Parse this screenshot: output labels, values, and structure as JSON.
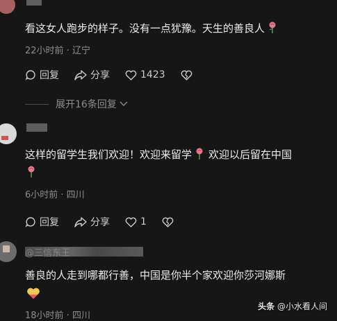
{
  "comments": [
    {
      "text": "看这女人跑步的样子。没有一点犹豫。天生的善良人",
      "meta": "22小时前 · 辽宁",
      "reply": "回复",
      "share": "分享",
      "likes": "1423",
      "dislike_icon": "broken-heart-icon"
    },
    {
      "text_line1": "这样的留学生我们欢迎！欢迎来留学",
      "text_line1b": "欢迎以后留在中国",
      "meta": "6小时前 · 四川",
      "reply": "回复",
      "share": "分享",
      "likes": "1"
    },
    {
      "username": "@三信东王",
      "text": "善良的人走到哪都行善，中国是你半个家欢迎你莎河娜斯",
      "meta": "18小时前 · 四川"
    }
  ],
  "expand_replies": "展开16条回复",
  "watermark": {
    "brand": "头条",
    "handle": "@小水看人间"
  },
  "colors": {
    "background": "#161616",
    "text": "#ececec",
    "meta": "#8d8d8d",
    "rose": "#e57a8a"
  }
}
